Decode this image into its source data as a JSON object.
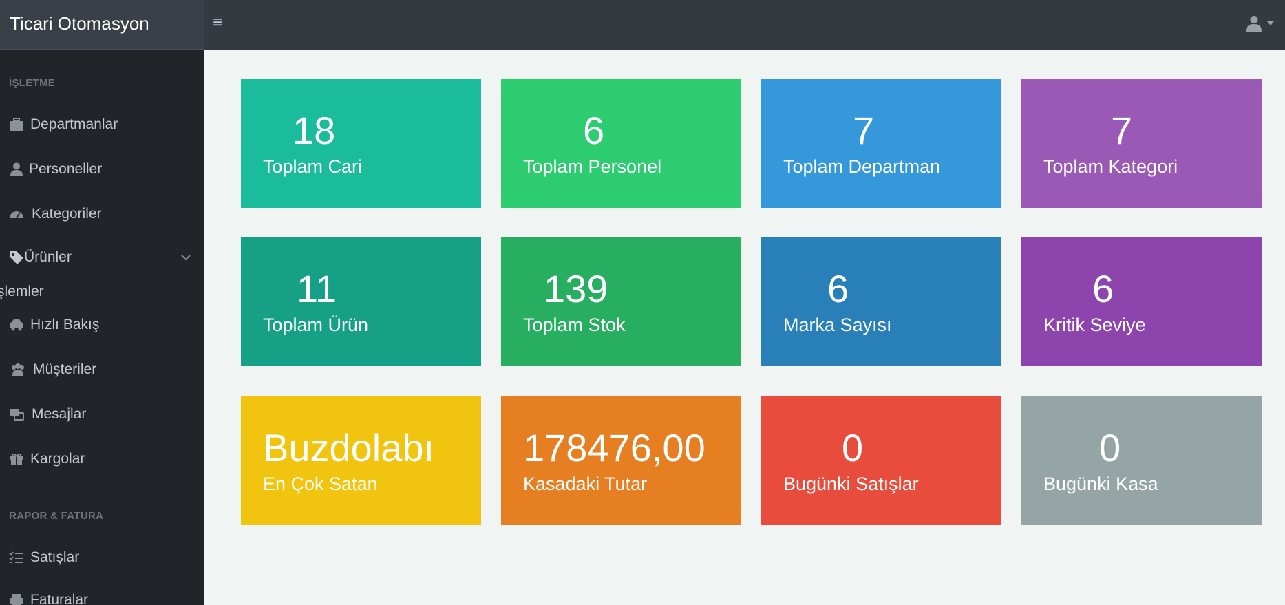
{
  "header": {
    "brand": "Ticari Otomasyon",
    "menu_icon": "hamburger-icon",
    "user_icon": "user-icon"
  },
  "sidebar": {
    "sections": [
      {
        "title": "İŞLETME"
      },
      {
        "title": "RAPOR & FATURA"
      }
    ],
    "items": [
      {
        "label": "Departmanlar",
        "icon": "briefcase-icon"
      },
      {
        "label": "Personeller",
        "icon": "user-icon"
      },
      {
        "label": "Kategoriler",
        "icon": "gauge-icon"
      },
      {
        "label": "Ürünler",
        "icon": "tag-icon"
      },
      {
        "label": "Hızlı Bakış",
        "icon": "car-icon"
      },
      {
        "label": "Müşteriler",
        "icon": "users-icon"
      },
      {
        "label": "Mesajlar",
        "icon": "message-icon"
      },
      {
        "label": "Kargolar",
        "icon": "gift-icon"
      },
      {
        "label": "Satışlar",
        "icon": "list-check-icon"
      },
      {
        "label": "Faturalar",
        "icon": "printer-icon"
      }
    ],
    "group_label": "şlemler"
  },
  "cards": [
    {
      "value": "18",
      "label": "Toplam Cari",
      "color": "#1abc9c"
    },
    {
      "value": "6",
      "label": "Toplam Personel",
      "color": "#2ecc71"
    },
    {
      "value": "7",
      "label": "Toplam Departman",
      "color": "#3498db"
    },
    {
      "value": "7",
      "label": "Toplam Kategori",
      "color": "#9b59b6"
    },
    {
      "value": "11",
      "label": "Toplam Ürün",
      "color": "#16a085"
    },
    {
      "value": "139",
      "label": "Toplam Stok",
      "color": "#27ae60"
    },
    {
      "value": "6",
      "label": "Marka Sayısı",
      "color": "#2980b9"
    },
    {
      "value": "6",
      "label": "Kritik Seviye",
      "color": "#8e44ad"
    },
    {
      "value": "Buzdolabı",
      "label": "En Çok Satan",
      "color": "#f1c40f"
    },
    {
      "value": "178476,00",
      "label": "Kasadaki Tutar",
      "color": "#e67e22"
    },
    {
      "value": "0",
      "label": "Bugünki Satışlar",
      "color": "#e74c3c"
    },
    {
      "value": "0",
      "label": "Bugünki Kasa",
      "color": "#95a5a6"
    }
  ]
}
